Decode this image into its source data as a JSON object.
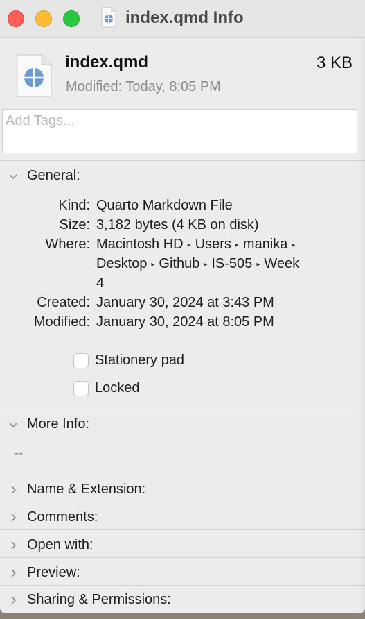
{
  "window": {
    "title": "index.qmd Info"
  },
  "file": {
    "name": "index.qmd",
    "size": "3 KB",
    "modified_line": "Modified: Today, 8:05 PM"
  },
  "tags": {
    "placeholder": "Add Tags..."
  },
  "general": {
    "header": "General:",
    "kind_label": "Kind:",
    "kind": "Quarto Markdown File",
    "size_label": "Size:",
    "size": "3,182 bytes (4 KB on disk)",
    "where_label": "Where:",
    "where_path": [
      "Macintosh HD",
      "Users",
      "manika",
      "Desktop",
      "Github",
      "IS-505",
      "Week",
      "4"
    ],
    "created_label": "Created:",
    "created": "January 30, 2024 at 3:43 PM",
    "modified_label": "Modified:",
    "modified": "January 30, 2024 at 8:05 PM",
    "stationery_label": "Stationery pad",
    "locked_label": "Locked"
  },
  "more_info": {
    "header": "More Info:",
    "value": "--"
  },
  "sections": {
    "name_ext": "Name & Extension:",
    "comments": "Comments:",
    "open_with": "Open with:",
    "preview": "Preview:",
    "sharing": "Sharing & Permissions:"
  },
  "icons": {
    "traffic_close": "#fe5f57",
    "traffic_min": "#febc2e",
    "traffic_max": "#28c840",
    "file_icon": "quarto-file-icon"
  }
}
